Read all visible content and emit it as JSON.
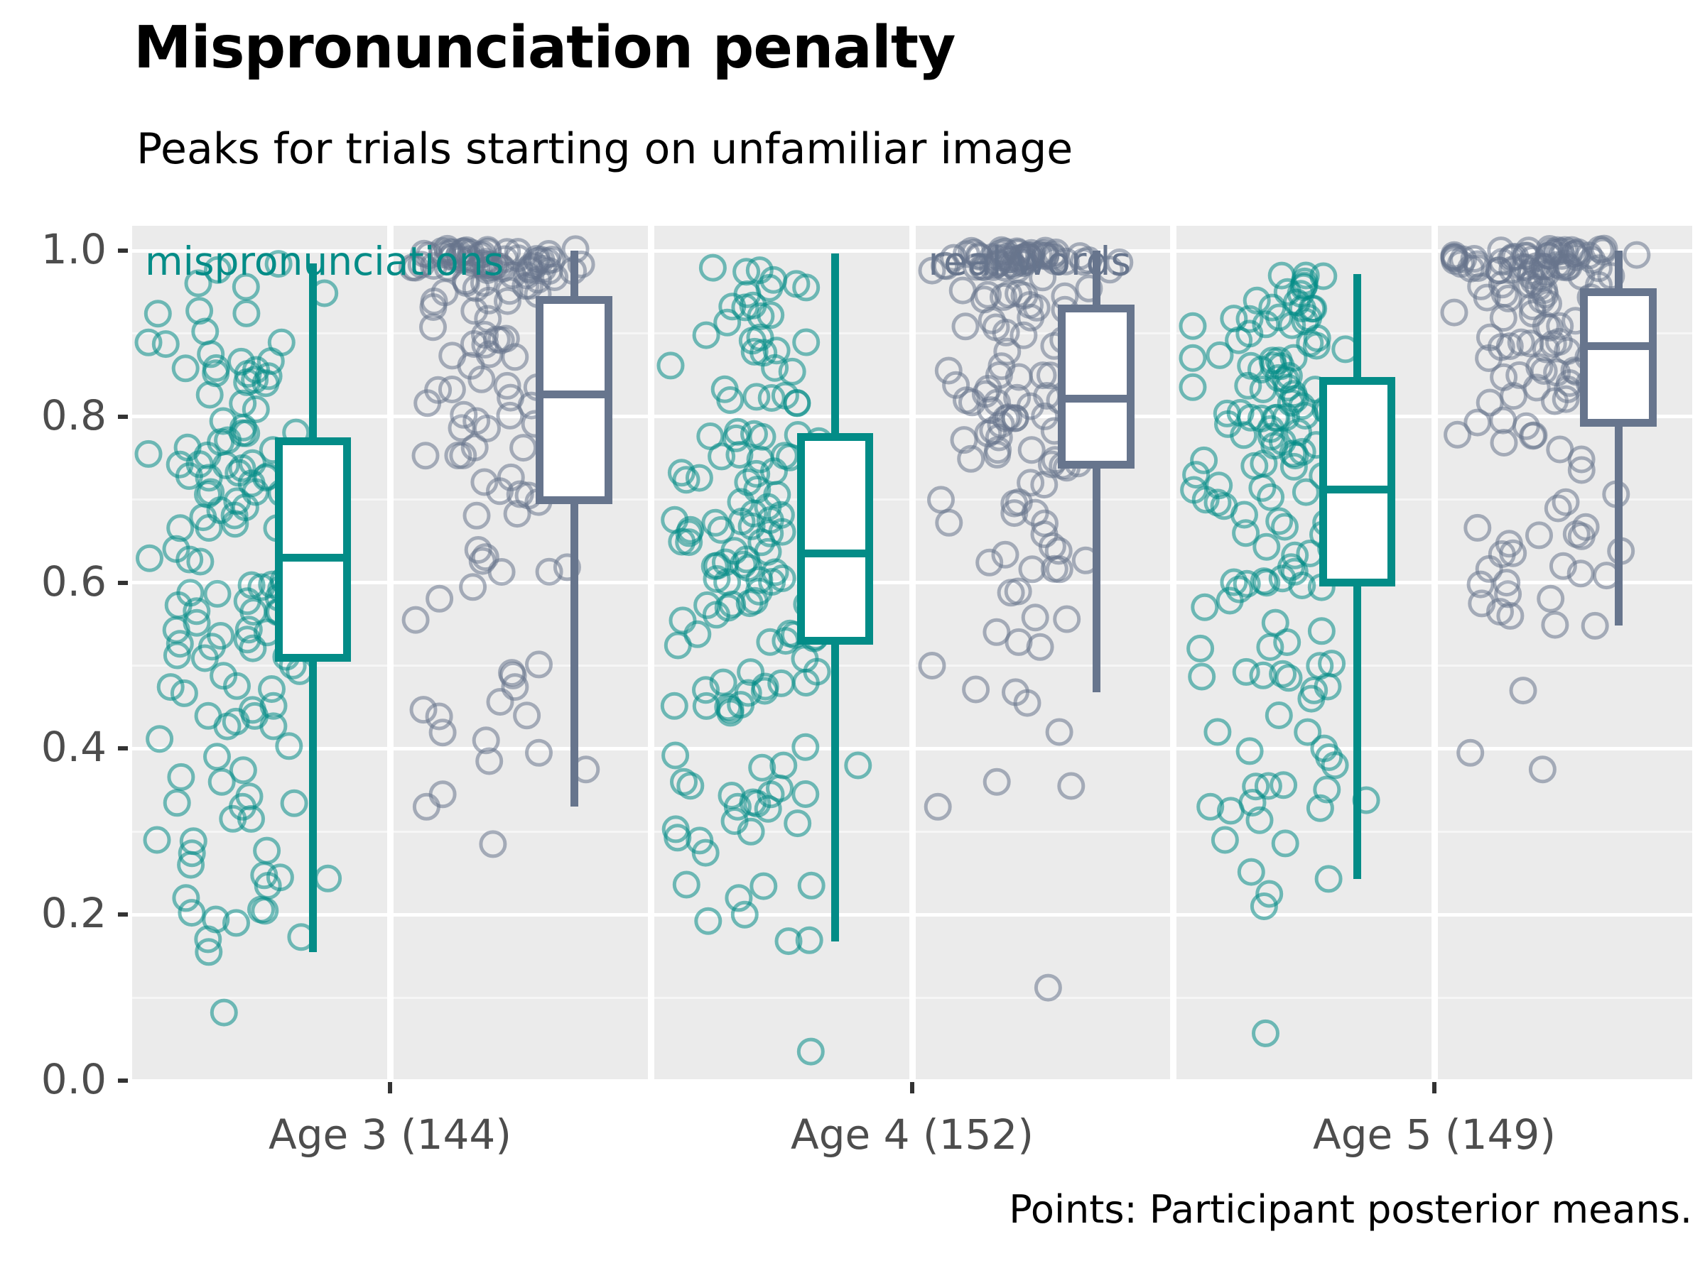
{
  "title": "Mispronunciation penalty",
  "subtitle": "Peaks for trials starting on unfamiliar image",
  "caption": "Points: Participant posterior means.",
  "strips": {
    "mispronunciations": "mispronunciations",
    "real_words": "real words"
  },
  "colors": {
    "mispronunciation": "#038c87",
    "real_word": "#67758d",
    "panel_background": "#ebebeb",
    "gridline": "#ffffff",
    "axis_text": "#4d4d4d",
    "box_fill": "#ffffff"
  },
  "chart_data": {
    "type": "boxplot",
    "title": "Mispronunciation penalty",
    "subtitle": "Peaks for trials starting on unfamiliar image",
    "caption": "Points: Participant posterior means.",
    "xlabel": "",
    "ylabel": "",
    "ylim": [
      0.0,
      1.03
    ],
    "grid": true,
    "legend_position": "in-panel-strip",
    "categories": [
      "Age 3 (144)",
      "Age 4 (152)",
      "Age 5 (149)"
    ],
    "group_counts": [
      144,
      152,
      149
    ],
    "yticks": [
      "0.0",
      "0.2",
      "0.4",
      "0.6",
      "0.8",
      "1.0"
    ],
    "ytick_values": [
      0.0,
      0.2,
      0.4,
      0.6,
      0.8,
      1.0
    ],
    "series": [
      {
        "name": "mispronunciations",
        "color": "#038c87",
        "boxes": [
          {
            "category": "Age 3 (144)",
            "lower_whisker": 0.155,
            "q1": 0.505,
            "median": 0.63,
            "q3": 0.775,
            "upper_whisker": 0.985
          },
          {
            "category": "Age 4 (152)",
            "lower_whisker": 0.168,
            "q1": 0.525,
            "median": 0.635,
            "q3": 0.78,
            "upper_whisker": 0.997
          },
          {
            "category": "Age 5 (149)",
            "lower_whisker": 0.243,
            "q1": 0.595,
            "median": 0.712,
            "q3": 0.848,
            "upper_whisker": 0.972
          }
        ]
      },
      {
        "name": "real words",
        "color": "#67758d",
        "boxes": [
          {
            "category": "Age 3 (144)",
            "lower_whisker": 0.33,
            "q1": 0.695,
            "median": 0.827,
            "q3": 0.945,
            "upper_whisker": 1.0
          },
          {
            "category": "Age 4 (152)",
            "lower_whisker": 0.468,
            "q1": 0.737,
            "median": 0.822,
            "q3": 0.935,
            "upper_whisker": 1.0
          },
          {
            "category": "Age 5 (149)",
            "lower_whisker": 0.548,
            "q1": 0.788,
            "median": 0.885,
            "q3": 0.955,
            "upper_whisker": 1.0
          }
        ]
      }
    ],
    "point_cloud_description": "Jittered open circles, one per participant posterior mean, drawn left of each box"
  }
}
